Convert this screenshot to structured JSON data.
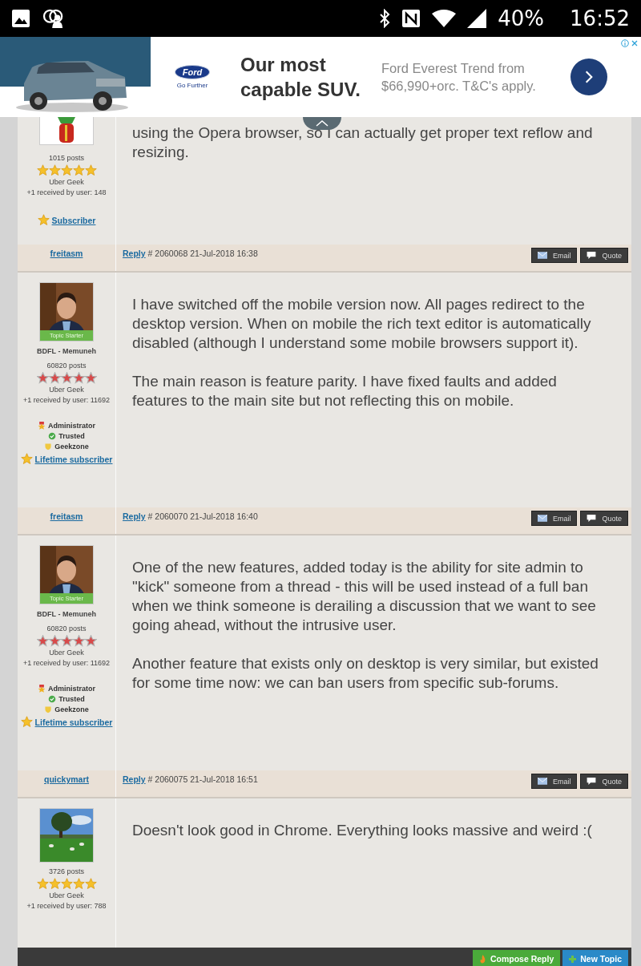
{
  "status_bar": {
    "battery": "40%",
    "time": "16:52"
  },
  "ad": {
    "logo_text": "Ford",
    "logo_tagline": "Go Further",
    "headline": "Our most capable SUV.",
    "description": "Ford Everest Trend from $66,990+orc. T&C's apply."
  },
  "posts": [
    {
      "author": {
        "posts": "1015 posts",
        "rating": {
          "stars": 5,
          "kind": "gold"
        },
        "rank": "Uber Geek",
        "received": "+1 received by user: 148",
        "badges": [
          {
            "kind": "subscriber",
            "label": "Subscriber",
            "link": true
          }
        ]
      },
      "body": [
        "using the Opera browser, so I can actually get proper text reflow and resizing."
      ],
      "footer": {
        "author": "freitasm",
        "reply": "Reply",
        "meta": "# 2060068 21-Jul-2018 16:38",
        "actions": [
          "Email",
          "Quote"
        ]
      }
    },
    {
      "author": {
        "avatar_label": "Topic Starter",
        "title": "BDFL - Memuneh",
        "posts": "60820 posts",
        "rating": {
          "stars": 5,
          "kind": "red"
        },
        "rank": "Uber Geek",
        "received": "+1 received by user: 11692",
        "badges": [
          {
            "kind": "administrator",
            "label": "Administrator",
            "link": false
          },
          {
            "kind": "trusted",
            "label": "Trusted",
            "link": false
          },
          {
            "kind": "geekzone",
            "label": "Geekzone",
            "link": false
          },
          {
            "kind": "subscriber",
            "label": "Lifetime subscriber",
            "link": true
          }
        ]
      },
      "body": [
        "I have switched off the mobile version now. All pages redirect to the desktop version. When on mobile the rich text editor is automatically disabled (although I understand some mobile browsers support it).",
        "The main reason is feature parity. I have fixed faults and added features to the main site but not reflecting this on mobile."
      ],
      "footer": {
        "author": "freitasm",
        "reply": "Reply",
        "meta": "# 2060070 21-Jul-2018 16:40",
        "actions": [
          "Email",
          "Quote"
        ]
      }
    },
    {
      "author": {
        "avatar_label": "Topic Starter",
        "title": "BDFL - Memuneh",
        "posts": "60820 posts",
        "rating": {
          "stars": 5,
          "kind": "red"
        },
        "rank": "Uber Geek",
        "received": "+1 received by user: 11692",
        "badges": [
          {
            "kind": "administrator",
            "label": "Administrator",
            "link": false
          },
          {
            "kind": "trusted",
            "label": "Trusted",
            "link": false
          },
          {
            "kind": "geekzone",
            "label": "Geekzone",
            "link": false
          },
          {
            "kind": "subscriber",
            "label": "Lifetime subscriber",
            "link": true
          }
        ]
      },
      "body": [
        "One of the new features, added today is the ability for site admin to \"kick\" someone from a thread - this will be used instead of a full ban when we think someone is derailing a discussion that we want to see going ahead, without the intrusive user.",
        "Another feature that exists only on desktop is very similar, but existed for some time now: we can ban users from specific sub-forums."
      ],
      "footer": {
        "author": "quickymart",
        "reply": "Reply",
        "meta": "# 2060075 21-Jul-2018 16:51",
        "actions": [
          "Email",
          "Quote"
        ]
      }
    },
    {
      "author": {
        "posts": "3726 posts",
        "rating": {
          "stars": 5,
          "kind": "gold"
        },
        "rank": "Uber Geek",
        "received": "+1 received by user: 788"
      },
      "body": [
        "Doesn't look good in Chrome. Everything looks massive and weird :("
      ]
    }
  ],
  "bottom_bar": {
    "buttons": [
      {
        "kind": "compose",
        "label": "Compose Reply"
      },
      {
        "kind": "new",
        "label": "New Topic"
      }
    ]
  }
}
